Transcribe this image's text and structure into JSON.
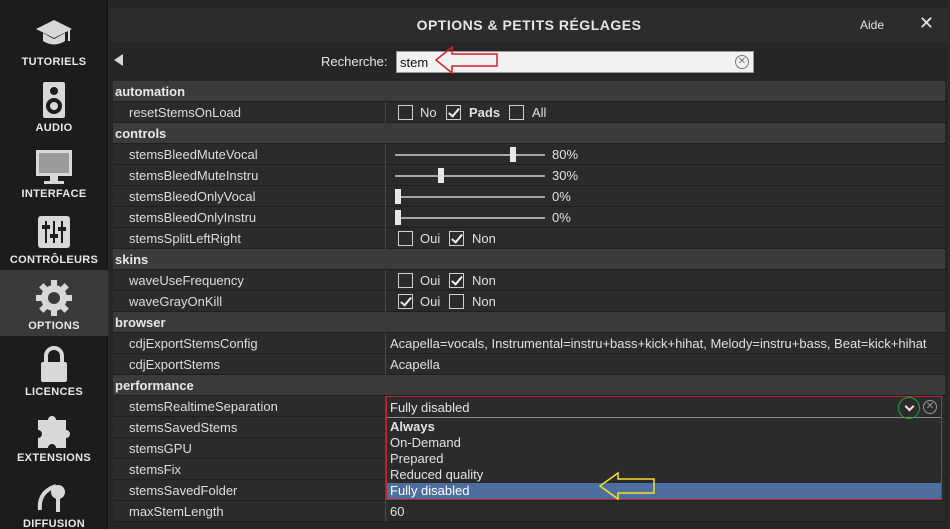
{
  "sidebar": {
    "items": [
      {
        "label": "TUTORIELS",
        "icon": "graduation-cap-icon"
      },
      {
        "label": "AUDIO",
        "icon": "speaker-icon"
      },
      {
        "label": "INTERFACE",
        "icon": "monitor-icon"
      },
      {
        "label": "CONTRÔLEURS",
        "icon": "mixer-sliders-icon"
      },
      {
        "label": "OPTIONS",
        "icon": "gear-icon",
        "active": true
      },
      {
        "label": "LICENCES",
        "icon": "lock-icon"
      },
      {
        "label": "EXTENSIONS",
        "icon": "puzzle-icon"
      },
      {
        "label": "DIFFUSION",
        "icon": "broadcast-icon"
      }
    ]
  },
  "header": {
    "title": "OPTIONS & PETITS RÉGLAGES",
    "help": "Aide",
    "close": "✕"
  },
  "search": {
    "label": "Recherche:",
    "value": "stem"
  },
  "sections": {
    "automation": "automation",
    "controls": "controls",
    "skins": "skins",
    "browser": "browser",
    "performance": "performance"
  },
  "rows": {
    "resetStemsOnLoad": {
      "name": "resetStemsOnLoad",
      "opt1": "No",
      "opt2": "Pads",
      "opt3": "All",
      "checked": "Pads"
    },
    "stemsBleedMuteVocal": {
      "name": "stemsBleedMuteVocal",
      "value": "80%",
      "level": 0.8
    },
    "stemsBleedMuteInstru": {
      "name": "stemsBleedMuteInstru",
      "value": "30%",
      "level": 0.3
    },
    "stemsBleedOnlyVocal": {
      "name": "stemsBleedOnlyVocal",
      "value": "0%",
      "level": 0
    },
    "stemsBleedOnlyInstru": {
      "name": "stemsBleedOnlyInstru",
      "value": "0%",
      "level": 0
    },
    "stemsSplitLeftRight": {
      "name": "stemsSplitLeftRight",
      "opt1": "Oui",
      "opt2": "Non",
      "checked": "Non"
    },
    "waveUseFrequency": {
      "name": "waveUseFrequency",
      "opt1": "Oui",
      "opt2": "Non",
      "checked": "Non"
    },
    "waveGrayOnKill": {
      "name": "waveGrayOnKill",
      "opt1": "Oui",
      "opt2": "Non",
      "checked": "Oui"
    },
    "cdjExportStemsConfig": {
      "name": "cdjExportStemsConfig",
      "value": "Acapella=vocals, Instrumental=instru+bass+kick+hihat, Melody=instru+bass, Beat=kick+hihat"
    },
    "cdjExportStems": {
      "name": "cdjExportStems",
      "value": "Acapella"
    },
    "stemsRealtimeSeparation": {
      "name": "stemsRealtimeSeparation",
      "value": "Fully disabled"
    },
    "stemsSavedStems": {
      "name": "stemsSavedStems"
    },
    "stemsGPU": {
      "name": "stemsGPU"
    },
    "stemsFix": {
      "name": "stemsFix"
    },
    "stemsSavedFolder": {
      "name": "stemsSavedFolder"
    },
    "maxStemLength": {
      "name": "maxStemLength",
      "value": "60"
    }
  },
  "dropdown": {
    "options": [
      "Always",
      "On-Demand",
      "Prepared",
      "Reduced quality",
      "Fully disabled"
    ],
    "selected": "Fully disabled"
  },
  "colors": {
    "selection": "#4e6ea0",
    "highlight_red": "#c0282e",
    "highlight_green": "#1fa83a",
    "highlight_yellow": "#f2e02a"
  }
}
